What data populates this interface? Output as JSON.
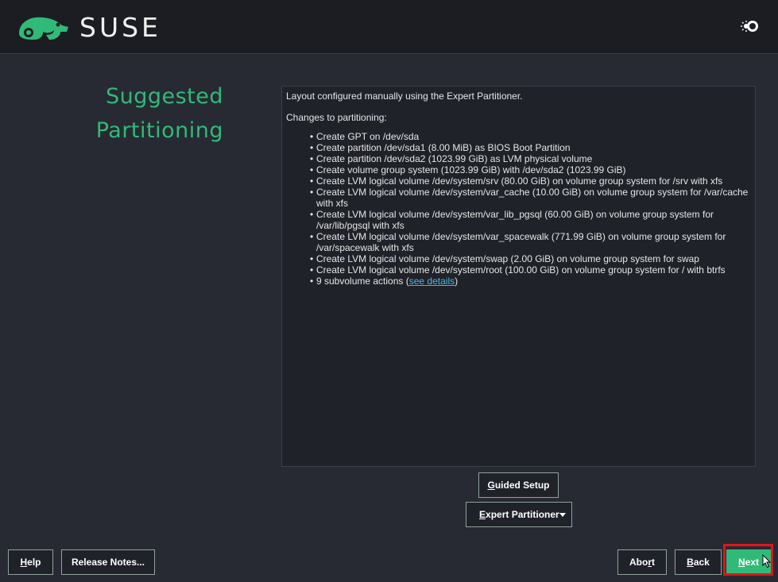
{
  "header": {
    "logo_text": "SUSE",
    "theme_toggle_icon": "sun-icon"
  },
  "page": {
    "title_line1": "Suggested",
    "title_line2": "Partitioning"
  },
  "summary": {
    "intro": "Layout configured manually using the Expert Partitioner.",
    "changes_heading": "Changes to partitioning:",
    "items": [
      "Create GPT on /dev/sda",
      "Create partition /dev/sda1 (8.00 MiB) as BIOS Boot Partition",
      "Create partition /dev/sda2 (1023.99 GiB) as LVM physical volume",
      "Create volume group system (1023.99 GiB) with /dev/sda2 (1023.99 GiB)",
      "Create LVM logical volume /dev/system/srv (80.00 GiB) on volume group system for /srv with xfs",
      "Create LVM logical volume /dev/system/var_cache (10.00 GiB) on volume group system for /var/cache with xfs",
      "Create LVM logical volume /dev/system/var_lib_pgsql (60.00 GiB) on volume group system for /var/lib/pgsql with xfs",
      "Create LVM logical volume /dev/system/var_spacewalk (771.99 GiB) on volume group system for /var/spacewalk with xfs",
      "Create LVM logical volume /dev/system/swap (2.00 GiB) on volume group system for swap",
      "Create LVM logical volume /dev/system/root (100.00 GiB) on volume group system for / with btrfs"
    ],
    "subvolume_prefix": "9 subvolume actions (",
    "subvolume_link": "see details",
    "subvolume_suffix": ")"
  },
  "actions": {
    "guided_setup_label_u": "G",
    "guided_setup_label_rest": "uided Setup",
    "expert_partitioner_label_u": "E",
    "expert_partitioner_label_rest": "xpert Partitioner"
  },
  "footer": {
    "help_u": "H",
    "help_rest": "elp",
    "release_notes": "Release Notes...",
    "abort_pre": "Abo",
    "abort_u": "r",
    "abort_post": "t",
    "back_u": "B",
    "back_rest": "ack",
    "next_u": "N",
    "next_rest": "ext"
  },
  "colors": {
    "accent": "#30ba78",
    "background": "#272a33",
    "header": "#1b1d23",
    "highlight": "#e0151a"
  }
}
